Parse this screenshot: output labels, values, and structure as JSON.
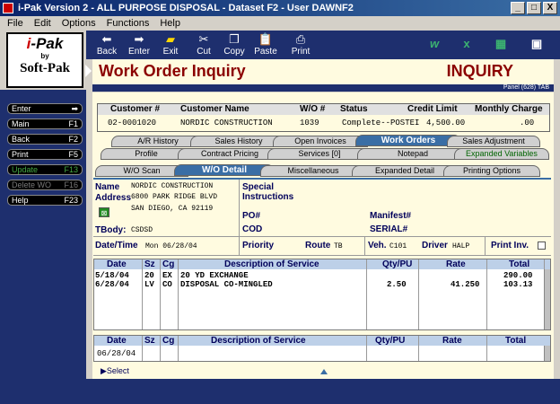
{
  "window": {
    "title": "i-Pak Version 2 - ALL PURPOSE DISPOSAL - Dataset F2 - User DAWNF2",
    "min": "_",
    "max": "□",
    "close": "X"
  },
  "menu": [
    "File",
    "Edit",
    "Options",
    "Functions",
    "Help"
  ],
  "toolbar": {
    "back": "Back",
    "enter": "Enter",
    "exit": "Exit",
    "cut": "Cut",
    "copy": "Copy",
    "paste": "Paste",
    "print": "Print"
  },
  "logo": {
    "line1_red": "i",
    "line1": "-Pak",
    "line2": "by",
    "line3": "Soft-Pak"
  },
  "sidebar": [
    {
      "label": "Enter",
      "key": "➡"
    },
    {
      "label": "Main",
      "key": "F1"
    },
    {
      "label": "Back",
      "key": "F2"
    },
    {
      "label": "Print",
      "key": "F5"
    },
    {
      "label": "Update",
      "key": "F13"
    },
    {
      "label": "Delete WO",
      "key": "F16"
    },
    {
      "label": "Help",
      "key": "F23"
    }
  ],
  "header": {
    "title": "Work Order Inquiry",
    "mode": "INQUIRY",
    "panel": "Panel (628) TAB"
  },
  "customer": {
    "h_num": "Customer #",
    "h_name": "Customer Name",
    "h_wo": "W/O #",
    "h_status": "Status",
    "h_credit": "Credit Limit",
    "h_charge": "Monthly Charge",
    "num": "02-0001020",
    "name": "NORDIC CONSTRUCTION",
    "wo": "1039",
    "status": "Complete--POSTEI",
    "credit": "4,500.00",
    "charge": ".00"
  },
  "tabs_row1": [
    "A/R History",
    "Sales History",
    "Open Invoices",
    "Work Orders",
    "Sales Adjustment"
  ],
  "tabs_row2": [
    "Profile",
    "Contract Pricing",
    "Services [0]",
    "Notepad",
    "Expanded Variables"
  ],
  "tabs_row3": [
    "W/O Scan",
    "W/O Detail",
    "Miscellaneous",
    "Expanded Detail",
    "Printing Options"
  ],
  "detail": {
    "name_lbl": "Name",
    "name": "NORDIC CONSTRUCTION",
    "addr_lbl": "Address",
    "addr1": "6800 PARK RIDGE BLVD",
    "addr2": "SAN DIEGO, CA 92119",
    "tbody_lbl": "TBody:",
    "tbody": "CSDSD",
    "special": "Special",
    "instructions": "Instructions",
    "po": "PO#",
    "cod": "COD",
    "manifest": "Manifest#",
    "serial": "SERIAL#",
    "dt_lbl": "Date/Time",
    "dt": "Mon 06/28/04",
    "priority": "Priority",
    "route_lbl": "Route",
    "route": "TB",
    "veh_lbl": "Veh.",
    "veh": "C101",
    "driver_lbl": "Driver",
    "driver": "HALP",
    "print_inv": "Print Inv."
  },
  "grid": {
    "headers": [
      "Date",
      "Sz",
      "Cg",
      "Description of Service",
      "Qty/PU",
      "Rate",
      "Total"
    ],
    "rows": [
      [
        "5/18/04",
        "20",
        "EX",
        "20 YD EXCHANGE",
        "",
        "",
        "290.00"
      ],
      [
        "6/28/04",
        "LV",
        "CO",
        "DISPOSAL CO-MINGLED",
        "2.50",
        "41.250",
        "103.13"
      ]
    ]
  },
  "entry": {
    "date": "06/28/04"
  },
  "footer": {
    "select": "Select"
  }
}
